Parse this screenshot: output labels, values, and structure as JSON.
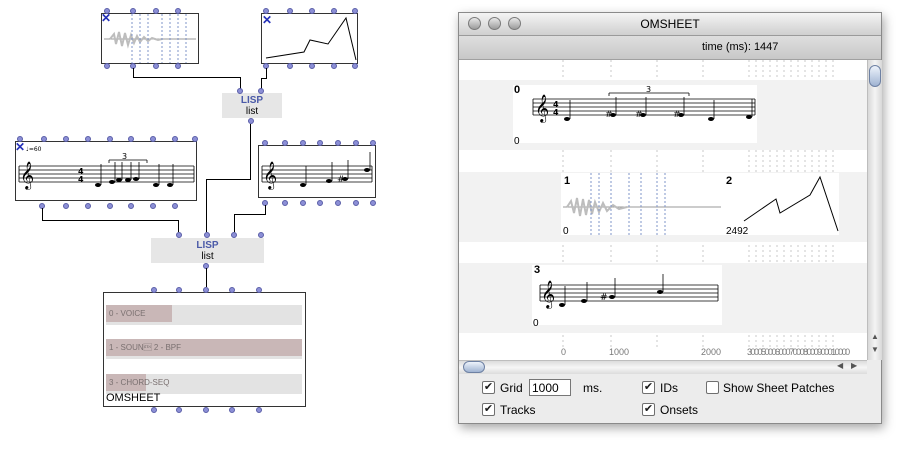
{
  "patch": {
    "lisp_boxes": [
      {
        "name": "LISP",
        "function": "list"
      },
      {
        "name": "LISP",
        "function": "list"
      }
    ],
    "voice_tempo": "♩=60",
    "tuplet": "3",
    "omsheet_box": {
      "label": "OMSHEET",
      "tracks": [
        "0 - VOICE",
        "1 - SOUN\u0002 2 - BPF",
        "3 - CHORD-SEQ"
      ]
    }
  },
  "window": {
    "title": "OMSHEET",
    "time_label": "time (ms): 1447",
    "tracks": [
      {
        "id": "0",
        "onset": "0",
        "tuplet": "3"
      },
      {
        "id": "1",
        "onset": "0"
      },
      {
        "id": "2",
        "onset": "2492"
      },
      {
        "id": "3",
        "onset": "0"
      }
    ],
    "ruler_ticks": [
      "0",
      "1000",
      "2000",
      "30005000600070008000900010000"
    ],
    "options": {
      "grid_label": "Grid",
      "grid_value": "1000",
      "grid_unit": "ms.",
      "ids_label": "IDs",
      "show_sheet_patches_label": "Show Sheet Patches",
      "tracks_label": "Tracks",
      "onsets_label": "Onsets",
      "grid_checked": true,
      "ids_checked": true,
      "tracks_checked": true,
      "onsets_checked": true,
      "show_sheet_patches_checked": false
    }
  },
  "colors": {
    "port": "#8c8fd6",
    "lisp_text": "#4b5aa8",
    "close_mark": "#2430b8",
    "grid_line": "#7f95c9"
  },
  "icons": [
    "close-x-icon",
    "treble-clef-icon",
    "window-close-icon",
    "window-minimize-icon",
    "window-zoom-icon",
    "scroll-left-arrow-icon",
    "scroll-right-arrow-icon",
    "scroll-up-arrow-icon",
    "scroll-down-arrow-icon"
  ]
}
